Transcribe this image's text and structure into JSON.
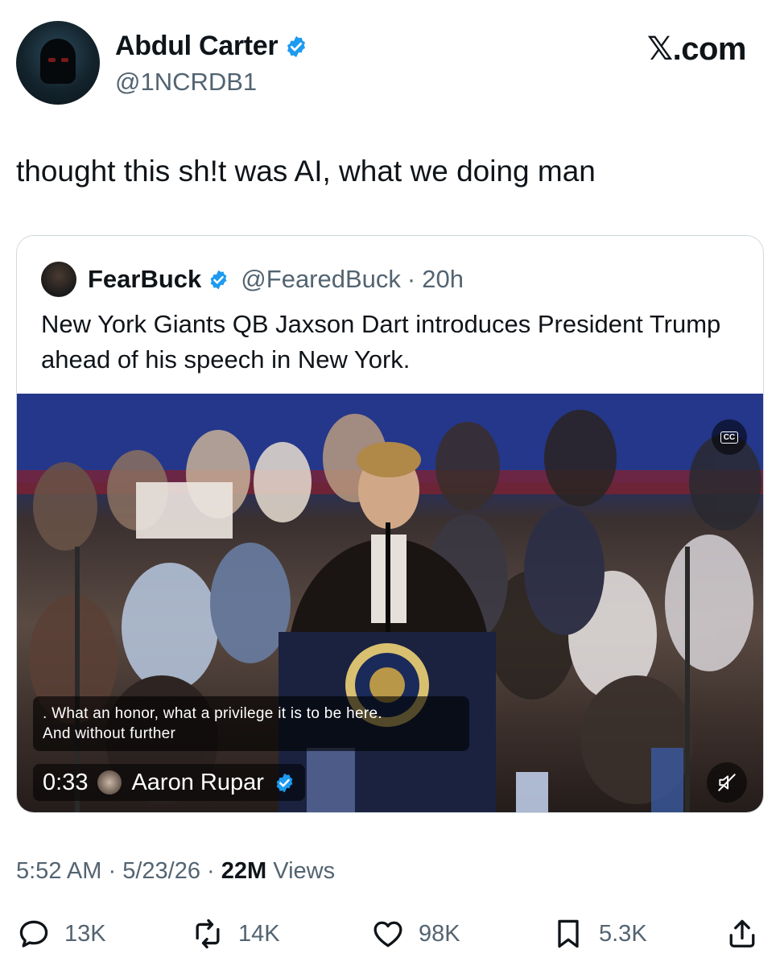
{
  "author": {
    "display_name": "Abdul Carter",
    "handle": "@1NCRDB1",
    "verified": true
  },
  "brand": "𝕏.com",
  "tweet": {
    "text": "thought this sh!t was AI, what we doing man"
  },
  "quote": {
    "display_name": "FearBuck",
    "handle": "@FearedBuck",
    "separator": "·",
    "age": "20h",
    "text": "New York Giants QB Jaxson Dart introduces President Trump ahead of his speech in New York.",
    "video": {
      "caption_line1": ". What an honor, what a privilege it is to be here.",
      "caption_line2": "And without further",
      "duration": "0:33",
      "source_name": "Aaron Rupar",
      "cc_label": "CC"
    }
  },
  "meta": {
    "time": "5:52 AM",
    "separator": "·",
    "date": "5/23/26",
    "views_count": "22M",
    "views_label": "Views"
  },
  "actions": {
    "replies": "13K",
    "reposts": "14K",
    "likes": "98K",
    "bookmarks": "5.3K"
  },
  "colors": {
    "verified": "#1d9bf0",
    "text_primary": "#0f1419",
    "text_secondary": "#536471",
    "border": "#cfd9de"
  }
}
